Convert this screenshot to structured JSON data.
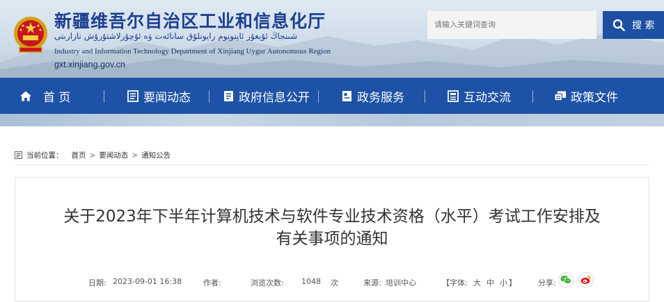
{
  "header": {
    "title": "新疆维吾尔自治区工业和信息化厅",
    "uyghur_title": "شىنجاڭ ئۇيغۇر ئاپتونوم رايونلۇق سانائەت ۋە ئۇچۇرلاشتۇرۇش نازارىتى",
    "english_title": "Industry and Information Technology Department of Xinjiang Uygur Autonomous Region",
    "domain": "gxt.xinjiang.gov.cn"
  },
  "search": {
    "placeholder": "请输入关键词查询",
    "button_label": "搜 索"
  },
  "nav": {
    "items": [
      {
        "label": "首 页",
        "icon": "home-icon"
      },
      {
        "label": "要闻动态",
        "icon": "news-icon"
      },
      {
        "label": "政府信息公开",
        "icon": "document-icon"
      },
      {
        "label": "政务服务",
        "icon": "service-icon"
      },
      {
        "label": "互动交流",
        "icon": "interaction-icon"
      },
      {
        "label": "政策文件",
        "icon": "policy-icon"
      }
    ]
  },
  "breadcrumb": {
    "prefix": "当前位置：",
    "items": [
      "首页",
      "要闻动态",
      "通知公告"
    ],
    "separator": ">"
  },
  "article": {
    "title_line1": "关于2023年下半年计算机技术与软件专业技术资格（水平）考试工作安排及",
    "title_line2": "有关事项的通知",
    "date_label": "日期:",
    "date": "2023-09-01 16:38",
    "author_label": "作者:",
    "views_label": "浏览次数:",
    "views": "1048",
    "views_unit": "次",
    "source_label": "来源:",
    "source": "培训中心",
    "font_size_label": "【字体:",
    "font_large": "大",
    "font_medium": "中",
    "font_small": "小",
    "font_size_close": "】",
    "share_label": "分享:"
  },
  "colors": {
    "nav_blue": "#1e52a6",
    "title_blue": "#1d3f8f",
    "wechat_green": "#3db034",
    "weibo_red": "#e6162d"
  }
}
